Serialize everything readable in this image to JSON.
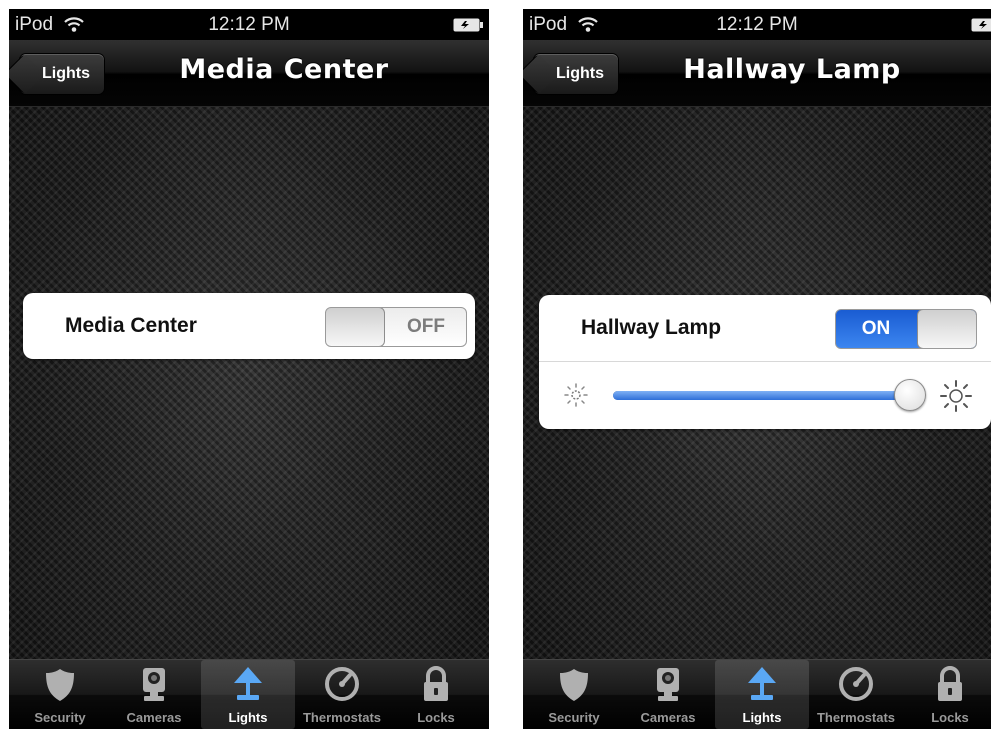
{
  "colors": {
    "accent_blue": "#3c86f0",
    "tab_selected_icon": "#5aa8f5",
    "tab_icon": "#b0b0b0"
  },
  "left_screen": {
    "status_bar": {
      "carrier": "iPod",
      "time": "12:12 PM",
      "wifi_icon": "wifi-icon",
      "battery_icon": "battery-icon"
    },
    "nav": {
      "back_label": "Lights",
      "title": "Media Center"
    },
    "device": {
      "name": "Media Center",
      "switch_state": "OFF"
    },
    "tabs": [
      {
        "label": "Security",
        "icon": "shield-icon",
        "selected": false
      },
      {
        "label": "Cameras",
        "icon": "camera-icon",
        "selected": false
      },
      {
        "label": "Lights",
        "icon": "lamp-icon",
        "selected": true
      },
      {
        "label": "Thermostats",
        "icon": "gauge-icon",
        "selected": false
      },
      {
        "label": "Locks",
        "icon": "padlock-icon",
        "selected": false
      }
    ]
  },
  "right_screen": {
    "status_bar": {
      "carrier": "iPod",
      "time": "12:12 PM",
      "wifi_icon": "wifi-icon",
      "battery_icon": "battery-icon"
    },
    "nav": {
      "back_label": "Lights",
      "title": "Hallway Lamp"
    },
    "device": {
      "name": "Hallway Lamp",
      "switch_state": "ON",
      "brightness_percent": 100
    },
    "tabs": [
      {
        "label": "Security",
        "icon": "shield-icon",
        "selected": false
      },
      {
        "label": "Cameras",
        "icon": "camera-icon",
        "selected": false
      },
      {
        "label": "Lights",
        "icon": "lamp-icon",
        "selected": true
      },
      {
        "label": "Thermostats",
        "icon": "gauge-icon",
        "selected": false
      },
      {
        "label": "Locks",
        "icon": "padlock-icon",
        "selected": false
      }
    ]
  }
}
